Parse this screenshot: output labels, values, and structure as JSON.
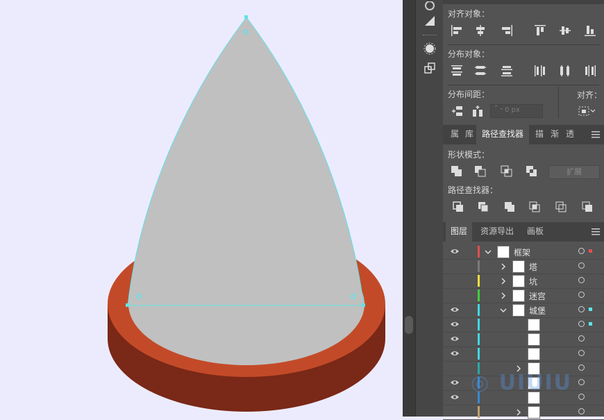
{
  "colors": {
    "canvas_bg": "#ecebfd",
    "cone_fill": "#c0c0c0",
    "selection": "#5fe3e8",
    "base_top": "#c34a28",
    "base_side": "#7a2817",
    "panel_bg": "#535353"
  },
  "align_panel": {
    "align_objects_label": "对齐对象：",
    "distribute_objects_label": "分布对象：",
    "distribute_spacing_label": "分布间距：",
    "align_to_label": "对齐：",
    "spacing_value": "0 px"
  },
  "pathfinder_tabs": {
    "tabs": [
      "属",
      "库",
      "路径查找器",
      "描",
      "渐",
      "透"
    ],
    "active": "路径查找器"
  },
  "pathfinder": {
    "shape_modes_label": "形状模式：",
    "expand_button": "扩展",
    "pathfinders_label": "路径查找器："
  },
  "layers_tabs": {
    "tabs": [
      "图层",
      "资源导出",
      "画板"
    ],
    "active": "图层"
  },
  "layers": [
    {
      "name": "框架",
      "visible": true,
      "color": "#e05050",
      "expanded": true,
      "indent": 0
    },
    {
      "name": "塔",
      "visible": false,
      "color": "#7a7a7a",
      "expanded": false,
      "indent": 1
    },
    {
      "name": "坑",
      "visible": false,
      "color": "#f0e040",
      "expanded": false,
      "indent": 1
    },
    {
      "name": "迷宫",
      "visible": false,
      "color": "#40d040",
      "expanded": false,
      "indent": 1
    },
    {
      "name": "城堡",
      "visible": true,
      "color": "#40d8e0",
      "expanded": true,
      "indent": 1
    },
    {
      "name": "",
      "visible": true,
      "color": "#40d8e0",
      "indent": 2
    },
    {
      "name": "",
      "visible": true,
      "color": "#40d8e0",
      "indent": 2
    },
    {
      "name": "",
      "visible": true,
      "color": "#40d8e0",
      "indent": 2
    },
    {
      "name": "",
      "visible": false,
      "color": "#2aa8a8",
      "expanded": false,
      "indent": 2
    },
    {
      "name": "",
      "visible": true,
      "color": "#3a8ad0",
      "indent": 2
    },
    {
      "name": "",
      "visible": true,
      "color": "#3a8ad0",
      "indent": 2
    },
    {
      "name": "",
      "visible": false,
      "color": "#c0a070",
      "expanded": false,
      "indent": 2
    }
  ]
}
